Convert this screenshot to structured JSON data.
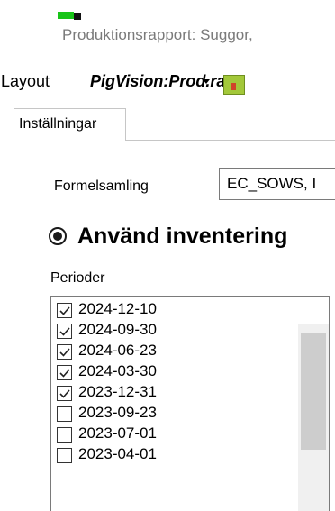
{
  "window": {
    "title": "Produktionsrapport: Suggor,",
    "icon": "app-icon"
  },
  "toolbar": {
    "layout_label": "Layout",
    "layout_value": "PigVision:Prod.rap"
  },
  "tabs": [
    {
      "label": "Inställningar",
      "active": true
    }
  ],
  "settings": {
    "formelsamling_label": "Formelsamling",
    "formelsamling_value": "EC_SOWS, I",
    "radio_label": "Använd inventering",
    "radio_selected": true,
    "perioder_label": "Perioder",
    "periods": [
      {
        "label": "2024-12-10",
        "checked": true
      },
      {
        "label": "2024-09-30",
        "checked": true
      },
      {
        "label": "2024-06-23",
        "checked": true
      },
      {
        "label": "2024-03-30",
        "checked": true
      },
      {
        "label": "2023-12-31",
        "checked": true
      },
      {
        "label": "2023-09-23",
        "checked": false
      },
      {
        "label": "2023-07-01",
        "checked": false
      },
      {
        "label": "2023-04-01",
        "checked": false
      }
    ]
  },
  "colors": {
    "icon_green": "#18c418",
    "title_gray": "#7a7a7a"
  }
}
